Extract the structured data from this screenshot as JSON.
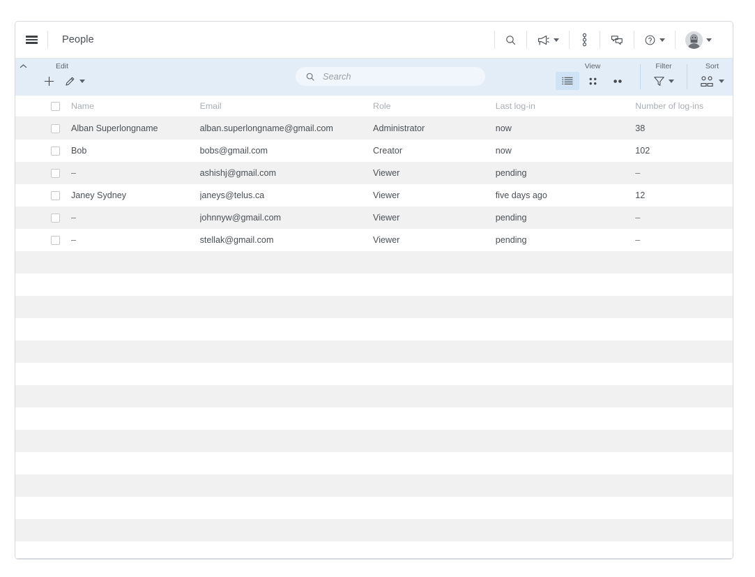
{
  "window": {
    "title": "People"
  },
  "header": {
    "menu_icon": "hamburger-menu-icon",
    "title": "People",
    "actions": [
      {
        "name": "search-icon",
        "label": "Search",
        "has_caret": false
      },
      {
        "name": "announcements-icon",
        "label": "Announcements",
        "has_caret": true
      },
      {
        "name": "workflow-icon",
        "label": "Workflow",
        "has_caret": false
      },
      {
        "name": "chat-icon",
        "label": "Chat",
        "has_caret": false
      },
      {
        "name": "help-icon",
        "label": "Help",
        "has_caret": true
      },
      {
        "name": "avatar",
        "label": "Account",
        "has_caret": true
      }
    ]
  },
  "toolbar": {
    "collapse_icon": "chevron-up-icon",
    "groups": [
      {
        "label": "Edit",
        "items": [
          {
            "name": "add-button",
            "icon": "plus-icon",
            "has_caret": false,
            "active": false
          },
          {
            "name": "edit-button",
            "icon": "pencil-icon",
            "has_caret": true,
            "active": false
          }
        ]
      },
      {
        "label": "View",
        "items": [
          {
            "name": "view-list-button",
            "icon": "list-view-icon",
            "has_caret": false,
            "active": true
          },
          {
            "name": "view-grid-button",
            "icon": "grid-view-icon",
            "has_caret": false,
            "active": false
          },
          {
            "name": "view-cards-button",
            "icon": "cards-view-icon",
            "has_caret": false,
            "active": false
          }
        ]
      },
      {
        "label": "Filter",
        "items": [
          {
            "name": "filter-button",
            "icon": "funnel-icon",
            "has_caret": true,
            "active": false
          }
        ]
      },
      {
        "label": "Sort",
        "items": [
          {
            "name": "sort-button",
            "icon": "people-sort-icon",
            "has_caret": true,
            "active": false
          }
        ]
      }
    ]
  },
  "search": {
    "icon": "search-icon",
    "value": "",
    "placeholder": "Search"
  },
  "table": {
    "columns": [
      {
        "key": "select",
        "label": ""
      },
      {
        "key": "name",
        "label": "Name"
      },
      {
        "key": "email",
        "label": "Email"
      },
      {
        "key": "role",
        "label": "Role"
      },
      {
        "key": "last",
        "label": "Last log-in"
      },
      {
        "key": "logins",
        "label": "Number of  log-ins"
      }
    ],
    "rows": [
      {
        "selected": false,
        "name": "Alban Superlongname",
        "email": "alban.superlongname@gmail.com",
        "role": "Administrator",
        "last": "now",
        "logins": "38"
      },
      {
        "selected": false,
        "name": "Bob",
        "email": "bobs@gmail.com",
        "role": "Creator",
        "last": "now",
        "logins": "102"
      },
      {
        "selected": false,
        "name": "–",
        "email": "ashishj@gmail.com",
        "role": "Viewer",
        "last": "pending",
        "logins": "–"
      },
      {
        "selected": false,
        "name": "Janey Sydney",
        "email": "janeys@telus.ca",
        "role": "Viewer",
        "last": "five days ago",
        "logins": "12"
      },
      {
        "selected": false,
        "name": "–",
        "email": "johnnyw@gmail.com",
        "role": "Viewer",
        "last": "pending",
        "logins": "–"
      },
      {
        "selected": false,
        "name": "–",
        "email": "stellak@gmail.com",
        "role": "Viewer",
        "last": "pending",
        "logins": "–"
      }
    ],
    "empty_row_count": 14
  },
  "colors": {
    "toolbar_bg": "#e2edf8",
    "toolbar_active": "#cfe2f6",
    "search_bg": "#f1f6fc",
    "row_stripe": "#f1f1f1",
    "text": "#4a4f54",
    "header_text": "#a9aeb3",
    "border": "#d5d9dd"
  }
}
